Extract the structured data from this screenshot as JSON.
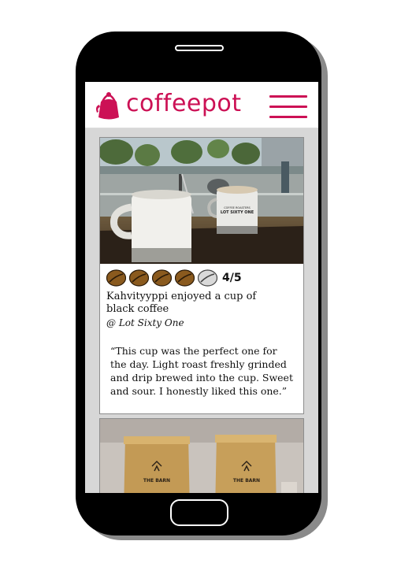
{
  "app": {
    "name": "coffeepot",
    "brand_color": "#cc1155"
  },
  "header": {
    "logo_text": "coffeepot",
    "logo_icon": "kettle-icon",
    "menu_icon": "hamburger-menu-icon"
  },
  "feed": {
    "posts": [
      {
        "rating": 4,
        "rating_max": 5,
        "rating_text": "4/5",
        "bean_icon": "coffee-bean-icon",
        "author_action": "Kahvityyppi enjoyed a cup of black coffee",
        "venue": "@ Lot Sixty One",
        "review": "“This cup was the perfect one for the day. Light roast freshly grinded and drip brewed into the cup. Sweet and sour. I honestly liked this one.”",
        "mug_print_line1": "COFFEE ROASTERS",
        "mug_print_line2": "LOT SIXTY ONE"
      },
      {
        "bag_label_left": "THE BARN",
        "bag_label_right": "THE BARN"
      }
    ]
  }
}
